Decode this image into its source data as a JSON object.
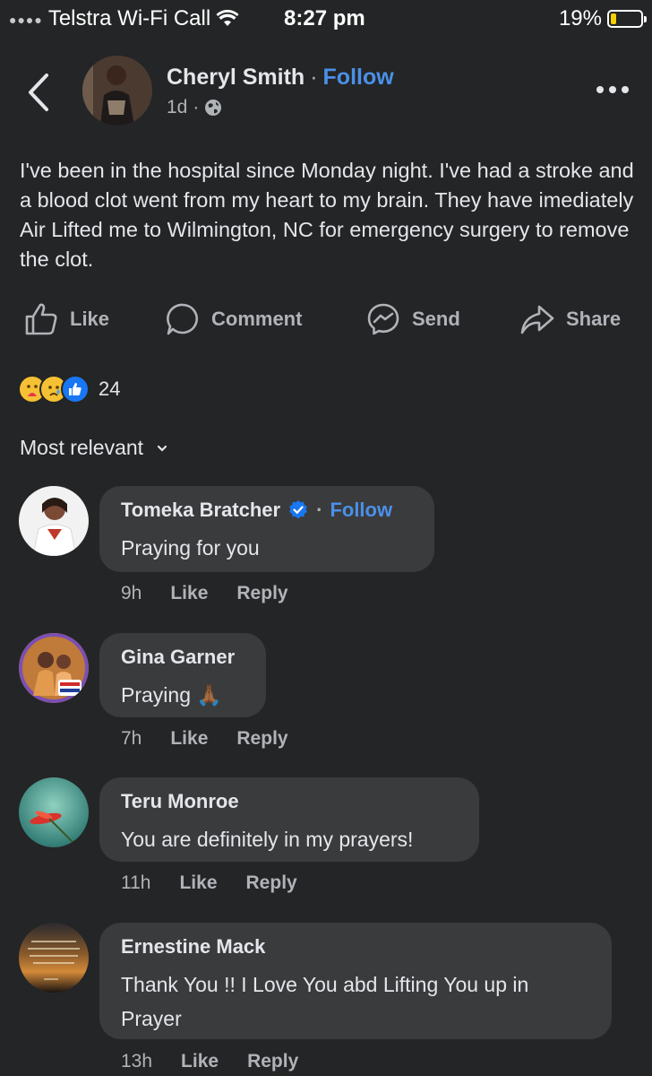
{
  "status_bar": {
    "carrier": "Telstra Wi-Fi Call",
    "time": "8:27 pm",
    "battery": "19%"
  },
  "post": {
    "author": "Cheryl Smith",
    "follow_label": "Follow",
    "age": "1d",
    "text": "I've been in the hospital since Monday night. I've had a stroke and a blood clot went from my heart to my brain. They have imediately Air Lifted me to Wilmington, NC for emergency surgery to remove the clot.",
    "actions": {
      "like": "Like",
      "comment": "Comment",
      "send": "Send",
      "share": "Share"
    },
    "reaction_count": "24"
  },
  "sort_label": "Most relevant",
  "comments": [
    {
      "name": "Tomeka Bratcher",
      "follow_label": "Follow",
      "text": "Praying for you",
      "age": "9h",
      "like": "Like",
      "reply": "Reply"
    },
    {
      "name": "Gina Garner",
      "text": "Praying 🙏🏾",
      "age": "7h",
      "like": "Like",
      "reply": "Reply"
    },
    {
      "name": "Teru Monroe",
      "text": "You are definitely in my prayers!",
      "age": "11h",
      "like": "Like",
      "reply": "Reply"
    },
    {
      "name": "Ernestine Mack",
      "text": "Thank You !! I Love You abd Lifting You up in Prayer",
      "age": "13h",
      "like": "Like",
      "reply": "Reply"
    }
  ],
  "colors": {
    "background": "#242526",
    "bubble": "#3a3b3c",
    "link": "#4a90e8",
    "text": "#e4e6eb",
    "secondary": "#b0b3b8"
  }
}
